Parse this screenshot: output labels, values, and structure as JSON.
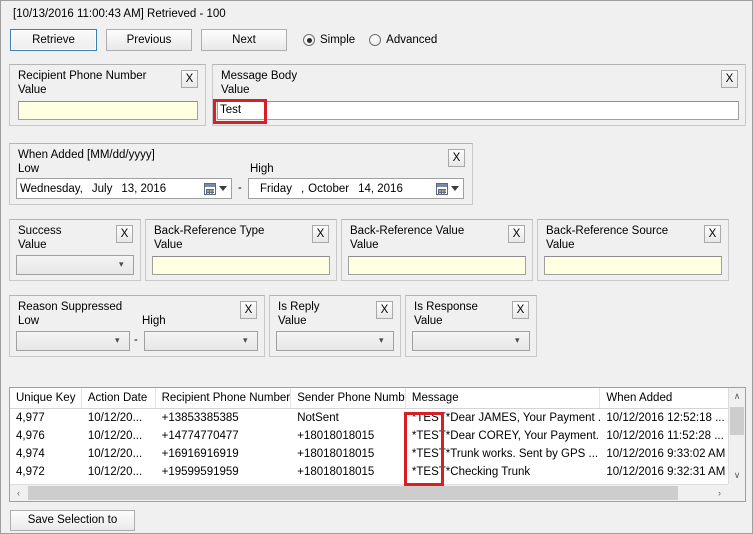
{
  "header": {
    "status": "[10/13/2016 11:00:43 AM] Retrieved - 100",
    "retrieve_label": "Retrieve",
    "previous_label": "Previous",
    "next_label": "Next",
    "mode_options": [
      {
        "label": "Simple",
        "selected": true
      },
      {
        "label": "Advanced",
        "selected": false
      }
    ]
  },
  "filters": {
    "recipient_phone": {
      "title": "Recipient Phone Number",
      "sub_label": "Value",
      "value": "",
      "clear_label": "X"
    },
    "message_body": {
      "title": "Message Body",
      "sub_label": "Value",
      "value": "Test",
      "clear_label": "X"
    },
    "when_added": {
      "title": "When Added [MM/dd/yyyy]",
      "low_label": "Low",
      "high_label": "High",
      "separator": "-",
      "clear_label": "X",
      "low": {
        "weekday": "Wednesday,",
        "month": "July",
        "day_year": "13, 2016"
      },
      "high": {
        "weekday": "Friday",
        "comma": ",",
        "month": "October",
        "day_year": "14, 2016"
      }
    },
    "success": {
      "title": "Success",
      "sub_label": "Value",
      "value": "",
      "clear_label": "X"
    },
    "back_reference_type": {
      "title": "Back-Reference Type",
      "sub_label": "Value",
      "value": "",
      "clear_label": "X"
    },
    "back_reference_value": {
      "title": "Back-Reference Value",
      "sub_label": "Value",
      "value": "",
      "clear_label": "X"
    },
    "back_reference_source": {
      "title": "Back-Reference Source",
      "sub_label": "Value",
      "value": "",
      "clear_label": "X"
    },
    "reason_suppressed": {
      "title": "Reason Suppressed",
      "low_label": "Low",
      "high_label": "High",
      "separator": "-",
      "low_value": "",
      "high_value": "",
      "clear_label": "X"
    },
    "is_reply": {
      "title": "Is Reply",
      "sub_label": "Value",
      "value": "",
      "clear_label": "X"
    },
    "is_response": {
      "title": "Is Response",
      "sub_label": "Value",
      "value": "",
      "clear_label": "X"
    }
  },
  "grid": {
    "columns": [
      "Unique Key",
      "Action Date",
      "Recipient Phone Number",
      "Sender Phone Number",
      "Message",
      "When Added"
    ],
    "rows": [
      {
        "unique_key": "4,977",
        "action_date": "10/12/20...",
        "recipient_phone": "+13853385385",
        "sender_phone": "NotSent",
        "message_tag": "*TEST*",
        "message_text": "Dear JAMES, Your Payment ...",
        "when_added": "10/12/2016 12:52:18 ..."
      },
      {
        "unique_key": "4,976",
        "action_date": "10/12/20...",
        "recipient_phone": "+14774770477",
        "sender_phone": "+18018018015",
        "message_tag": "*TEST*",
        "message_text": "Dear COREY, Your Payment..",
        "when_added": "10/12/2016 11:52:28 ..."
      },
      {
        "unique_key": "4,974",
        "action_date": "10/12/20...",
        "recipient_phone": "+16916916919",
        "sender_phone": "+18018018015",
        "message_tag": "*TEST*",
        "message_text": "Trunk works.  Sent by GPS ...",
        "when_added": "10/12/2016 9:33:02 AM"
      },
      {
        "unique_key": "4,972",
        "action_date": "10/12/20...",
        "recipient_phone": "+19599591959",
        "sender_phone": "+18018018015",
        "message_tag": "*TEST*",
        "message_text": "Checking Trunk",
        "when_added": "10/12/2016 9:32:31 AM"
      }
    ],
    "scroll_up_icon": "∧",
    "scroll_down_icon": "∨",
    "scroll_left_icon": "‹",
    "scroll_right_icon": "›"
  },
  "footer": {
    "save_csv_label": "Save Selection to CSV"
  },
  "annotations": {
    "accent_color": "#d81f26",
    "message_body_highlight": "Test",
    "message_column_highlight": "*TEST*"
  }
}
